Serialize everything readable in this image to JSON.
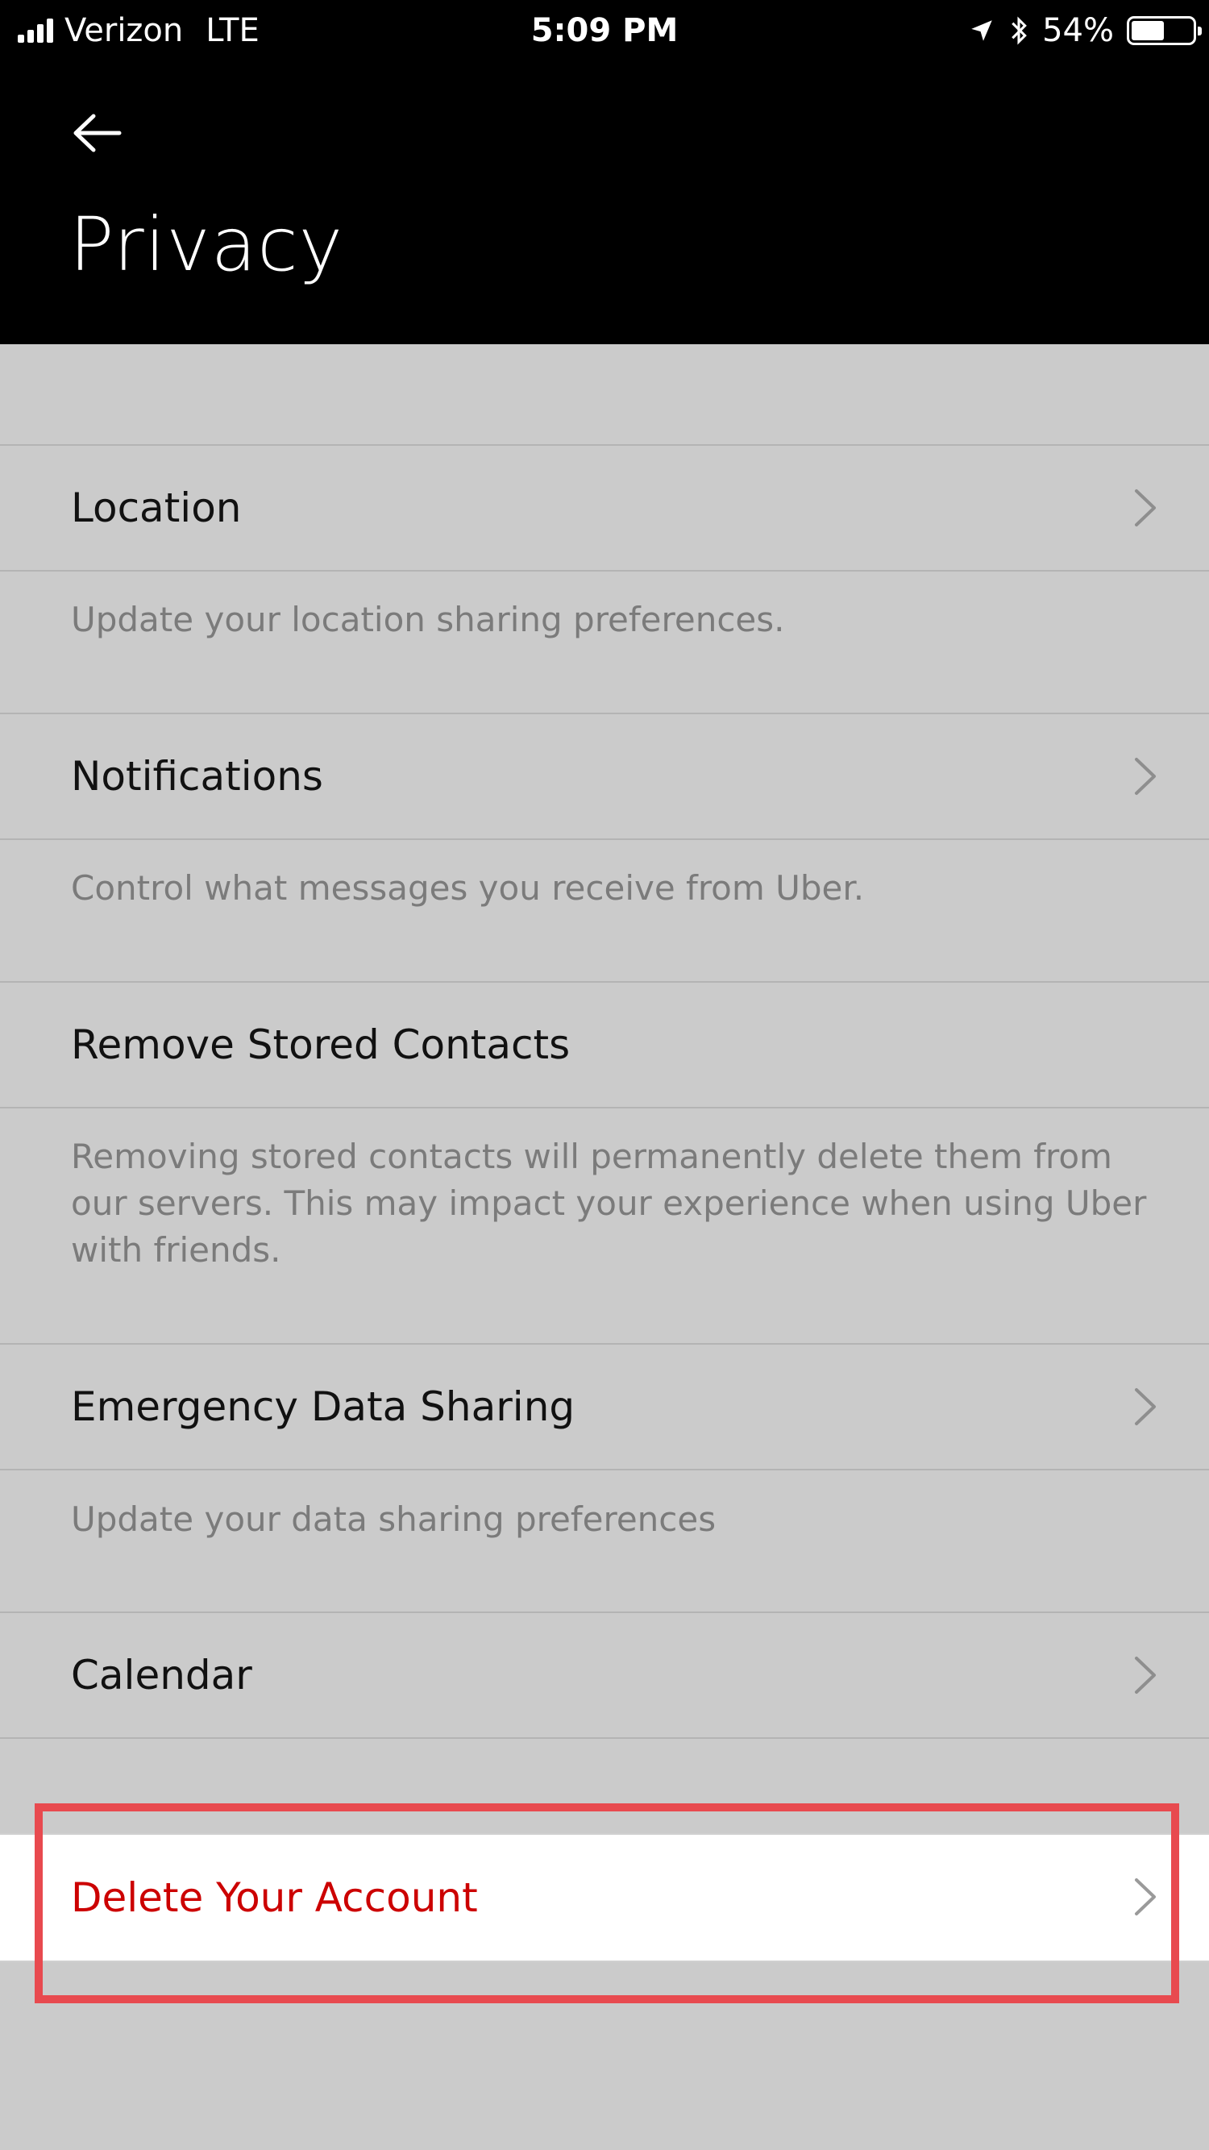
{
  "status_bar": {
    "carrier": "Verizon",
    "network": "LTE",
    "time": "5:09 PM",
    "battery_percent": "54%",
    "battery_level": 0.54,
    "icons": [
      "signal-bars-icon",
      "location-arrow-icon",
      "bluetooth-icon",
      "battery-icon"
    ]
  },
  "header": {
    "back_icon": "arrow-left-icon",
    "title": "Privacy"
  },
  "settings": {
    "location": {
      "label": "Location",
      "description": "Update your location sharing preferences."
    },
    "notifications": {
      "label": "Notifications",
      "description": "Control what messages you receive from Uber."
    },
    "stored_contacts": {
      "label": "Remove Stored Contacts",
      "description": "Removing stored contacts will permanently delete them from our servers. This may impact your experience when using Uber with friends."
    },
    "emergency": {
      "label": "Emergency Data Sharing",
      "description": "Update your data sharing preferences"
    },
    "calendar": {
      "label": "Calendar"
    },
    "delete_account": {
      "label": "Delete Your Account"
    }
  },
  "colors": {
    "background": "#cbcbcb",
    "header": "#000000",
    "danger_text": "#cc0000",
    "highlight": "#e84a4f"
  }
}
